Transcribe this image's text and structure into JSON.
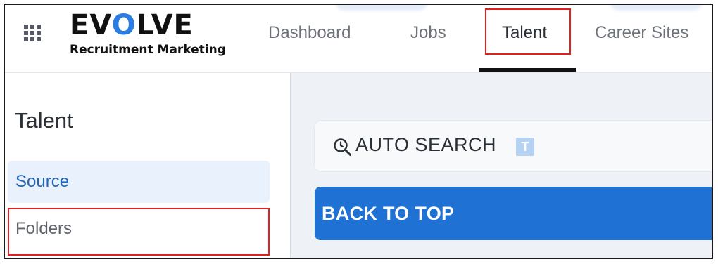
{
  "header": {
    "logo": {
      "title_pre": "EV",
      "title_o": "O",
      "title_post": "LVE",
      "subtitle": "Recruitment Marketing"
    },
    "nav": [
      {
        "label": "Dashboard"
      },
      {
        "label": "Jobs"
      },
      {
        "label": "Talent",
        "active": true
      },
      {
        "label": "Career Sites"
      }
    ]
  },
  "sidebar": {
    "title": "Talent",
    "items": [
      {
        "label": "Source",
        "selected": true
      },
      {
        "label": "Folders",
        "selected": false
      }
    ]
  },
  "main": {
    "auto_search": {
      "label": "AUTO SEARCH",
      "badge": "T",
      "icon": "search-clock-icon"
    },
    "back_to_top": {
      "label": "BACK TO TOP"
    }
  },
  "colors": {
    "accent": "#1f72d3",
    "logo_o": "#2a7de1",
    "selected_bg": "#e8f1fc",
    "highlight_box": "#e02020"
  }
}
